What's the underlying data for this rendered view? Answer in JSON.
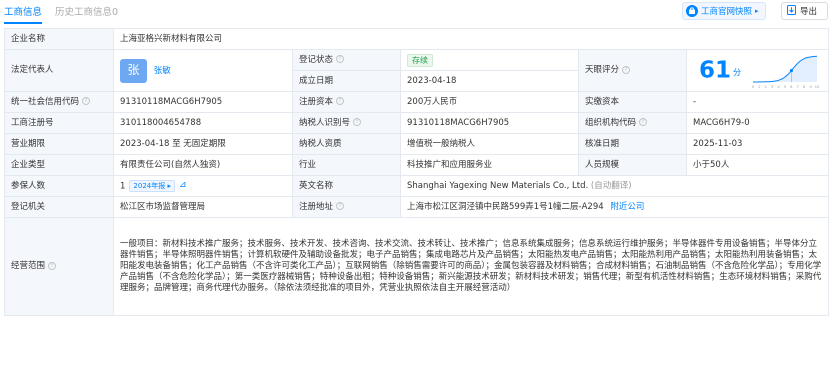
{
  "tabs": {
    "active": "工商信息",
    "inactive": "历史工商信息0"
  },
  "actions": {
    "snapshot_label": "工商官网快照",
    "export_label": "导出"
  },
  "labels": {
    "company_name": "企业名称",
    "legal_rep": "法定代表人",
    "reg_status": "登记状态",
    "found_date": "成立日期",
    "tianyan_score": "天眼评分",
    "credit_code": "统一社会信用代码",
    "reg_capital": "注册资本",
    "paid_capital": "实缴资本",
    "reg_number": "工商注册号",
    "taxpayer_id": "纳税人识别号",
    "org_code": "组织机构代码",
    "business_term": "营业期限",
    "taxpayer_qual": "纳税人资质",
    "approval_date": "核准日期",
    "company_type": "企业类型",
    "industry": "行业",
    "staff_size": "人员规模",
    "insured": "参保人数",
    "english_name": "英文名称",
    "reg_authority": "登记机关",
    "reg_address": "注册地址",
    "business_scope": "经营范围"
  },
  "values": {
    "company_name": "上海亚格兴新材料有限公司",
    "legal_rep_avatar": "张",
    "legal_rep_name": "张敏",
    "reg_status": "存续",
    "found_date": "2023-04-18",
    "score": "61",
    "score_unit": "分",
    "credit_code": "91310118MACG6H7905",
    "reg_capital": "200万人民币",
    "paid_capital": "-",
    "reg_number": "310118004654788",
    "taxpayer_id": "91310118MACG6H7905",
    "org_code": "MACG6H79-0",
    "business_term": "2023-04-18 至 无固定期限",
    "taxpayer_qual": "增值税一般纳税人",
    "approval_date": "2025-11-03",
    "company_type": "有限责任公司(自然人独资)",
    "industry": "科技推广和应用服务业",
    "staff_size": "小于50人",
    "insured": "1",
    "insured_year": "2024年报",
    "english_name": "Shanghai Yagexing New Materials Co., Ltd.",
    "english_name_note": "(自动翻译)",
    "reg_authority": "松江区市场监督管理局",
    "reg_address": "上海市松江区洞泾镇中民路599弄1号1幢二层-A294",
    "nearby_link": "附近公司",
    "business_scope": "一般项目：新材料技术推广服务；技术服务、技术开发、技术咨询、技术交流、技术转让、技术推广；信息系统集成服务；信息系统运行维护服务；半导体器件专用设备销售；半导体分立器件销售；半导体照明器件销售；计算机软硬件及辅助设备批发；电子产品销售；集成电路芯片及产品销售；太阳能热发电产品销售；太阳能热利用产品销售；太阳能热利用装备销售；太阳能发电装备销售；化工产品销售（不含许可类化工产品）；互联网销售（除销售需要许可的商品）；金属包装容器及材料销售；合成材料销售；石油制品销售（不含危险化学品）；专用化学产品销售（不含危险化学品）；第一类医疗器械销售；特种设备出租；特种设备销售；新兴能源技术研发；新材料技术研发；销售代理；新型有机活性材料销售；生态环境材料销售；采购代理服务；品牌管理；商务代理代办服务。（除依法须经批准的项目外，凭营业执照依法自主开展经营活动）"
  },
  "score_chart": {
    "x_ticks": [
      "0",
      "1",
      "2",
      "3",
      "4",
      "5",
      "6",
      "7",
      "8",
      "9",
      "10"
    ],
    "highlight_x": 6
  },
  "colors": {
    "accent": "#0084ff",
    "label_bg": "#f4f7fc",
    "status_green": "#1fa049",
    "border": "#e4e8ef"
  }
}
